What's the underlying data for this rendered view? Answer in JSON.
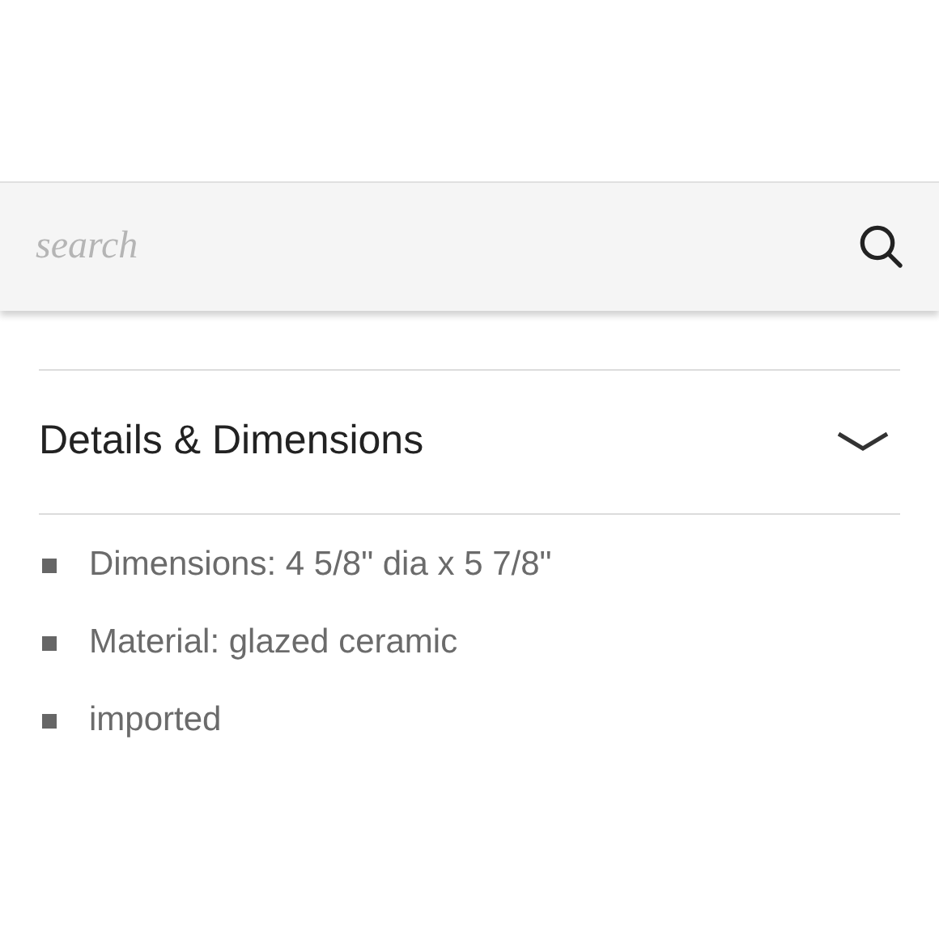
{
  "search": {
    "placeholder": "search"
  },
  "section": {
    "title": "Details & Dimensions",
    "expanded": true,
    "items": [
      "Dimensions: 4 5/8\" dia x 5 7/8\"",
      "Material: glazed ceramic",
      "imported"
    ]
  }
}
